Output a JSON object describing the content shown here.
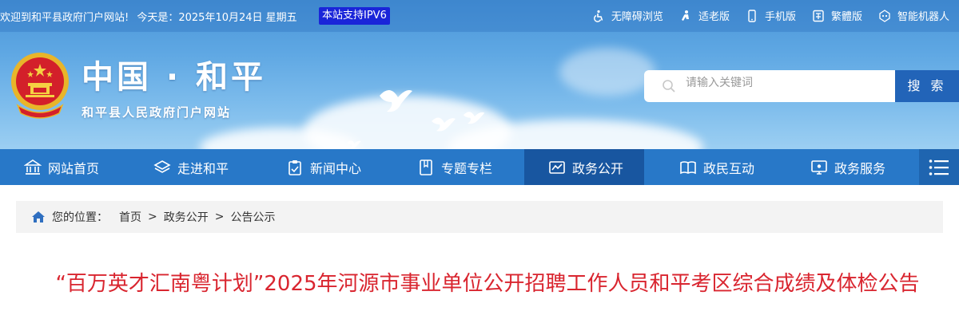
{
  "topbar": {
    "welcome": "欢迎到和平县政府门户网站!",
    "date": "今天是：2025年10月24日 星期五",
    "ipv6": "本站支持IPV6",
    "links": [
      "无障碍浏览",
      "适老版",
      "手机版",
      "繁體版",
      "智能机器人"
    ]
  },
  "header": {
    "title": "中国 · 和平",
    "subtitle": "和平县人民政府门户网站"
  },
  "search": {
    "placeholder": "请输入关键词",
    "button": "搜 索"
  },
  "nav": {
    "items": [
      "网站首页",
      "走进和平",
      "新闻中心",
      "专题专栏",
      "政务公开",
      "政民互动",
      "政务服务"
    ],
    "active": "政务公开"
  },
  "breadcrumb": {
    "label": "您的位置：",
    "items": [
      "首页",
      "政务公开",
      "公告公示"
    ],
    "separator": ">"
  },
  "article": {
    "title": "“百万英才汇南粤计划”2025年河源市事业单位公开招聘工作人员和平考区综合成绩及体检公告"
  },
  "colors": {
    "nav": "#2878c8",
    "nav_active": "#1856a0",
    "title_red": "#d9252f",
    "ipv6_badge": "#1a25d9"
  }
}
